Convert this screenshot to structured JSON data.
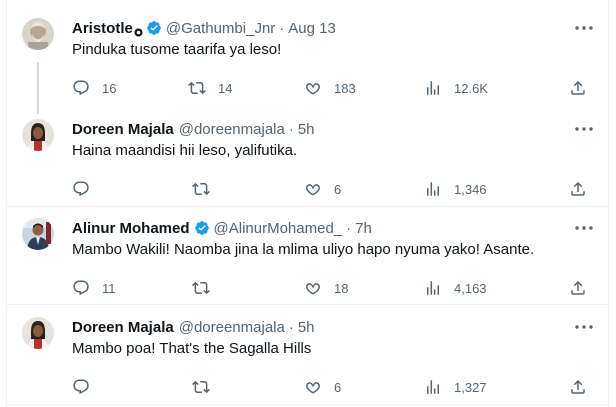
{
  "tweets": [
    {
      "name": "Aristotle",
      "has_gold_badge": true,
      "verified": true,
      "handle": "@Gathumbi_Jnr",
      "separator": "·",
      "time": "Aug 13",
      "text": "Pinduka tusome taarifa ya leso!",
      "reply_count": "16",
      "retweet_count": "14",
      "like_count": "183",
      "view_count": "12.6K"
    },
    {
      "name": "Doreen Majala",
      "verified": false,
      "handle": "@doreenmajala",
      "separator": "·",
      "time": "5h",
      "text": "Haina maandisi hii leso, yalifutika.",
      "reply_count": "",
      "retweet_count": "",
      "like_count": "6",
      "view_count": "1,346"
    },
    {
      "name": "Alinur Mohamed",
      "verified": true,
      "handle": "@AlinurMohamed_",
      "separator": "·",
      "time": "7h",
      "text": "Mambo Wakili! Naomba jina la mlima uliyo hapo nyuma yako! Asante.",
      "reply_count": "11",
      "retweet_count": "",
      "like_count": "18",
      "view_count": "4,163"
    },
    {
      "name": "Doreen Majala",
      "verified": false,
      "handle": "@doreenmajala",
      "separator": "·",
      "time": "5h",
      "text": "Mambo poa! That's the Sagalla Hills",
      "reply_count": "",
      "retweet_count": "",
      "like_count": "6",
      "view_count": "1,327"
    }
  ],
  "colors": {
    "text_primary": "#0f1419",
    "text_secondary": "#536471",
    "verified_blue": "#1d9bf0",
    "divider": "#eff3f4",
    "thread_line": "#cfd9de"
  },
  "icons": {
    "reply": "reply-icon",
    "retweet": "retweet-icon",
    "like": "heart-icon",
    "views": "views-icon",
    "share": "share-icon",
    "more": "more-icon",
    "verified": "verified-badge-icon"
  }
}
